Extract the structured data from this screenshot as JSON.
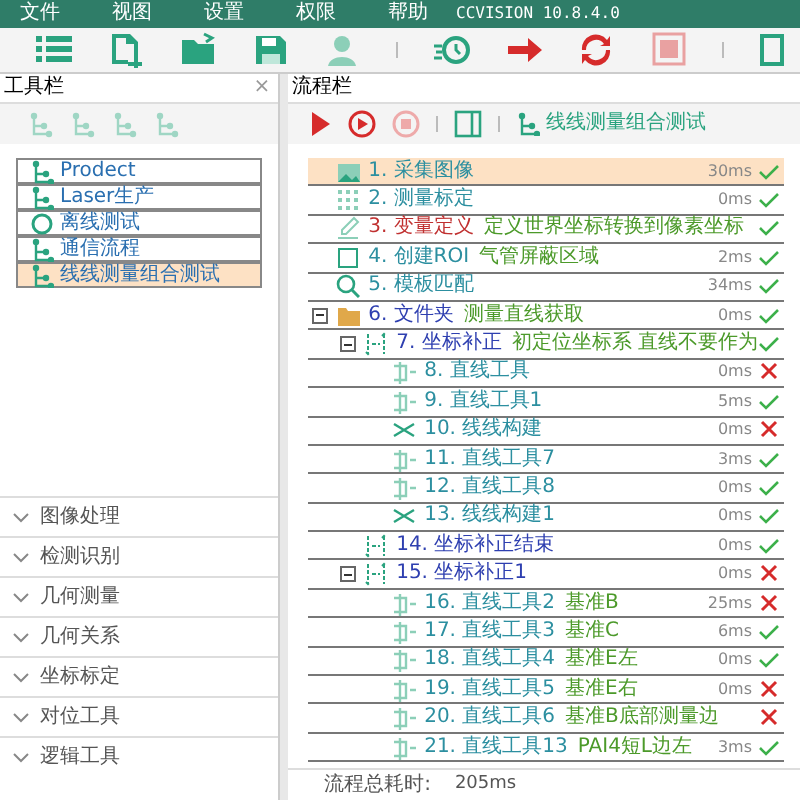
{
  "menu": {
    "items": [
      "文件",
      "视图",
      "设置",
      "权限",
      "帮助"
    ],
    "version": "CCVISION 10.8.4.0"
  },
  "toolbar": [
    {
      "kind": "list"
    },
    {
      "kind": "new"
    },
    {
      "kind": "open"
    },
    {
      "kind": "save"
    },
    {
      "kind": "user"
    },
    {
      "kind": "sep"
    },
    {
      "kind": "timer"
    },
    {
      "kind": "arrow"
    },
    {
      "kind": "refresh"
    },
    {
      "kind": "stop"
    },
    {
      "kind": "sep"
    },
    {
      "kind": "partial"
    }
  ],
  "tool_panel": {
    "title": "工具栏",
    "close": "×",
    "projects": [
      {
        "kind": "flow",
        "label": "Prodect",
        "selected": false
      },
      {
        "kind": "flow",
        "label": "Laser生产",
        "selected": false
      },
      {
        "kind": "ring",
        "label": "离线测试",
        "selected": false
      },
      {
        "kind": "flow",
        "label": "通信流程",
        "selected": false
      },
      {
        "kind": "flow",
        "label": "线线测量组合测试",
        "selected": true
      }
    ],
    "groups": [
      "图像处理",
      "检测识别",
      "几何测量",
      "几何关系",
      "坐标标定",
      "对位工具",
      "逻辑工具"
    ]
  },
  "flow_panel": {
    "title": "流程栏",
    "flow_name": "线线测量组合测试",
    "steps": [
      {
        "kind": "image",
        "name": "1. 采集图像",
        "time": "30ms",
        "ok": true,
        "selected": true
      },
      {
        "kind": "grid",
        "name": "2. 测量标定",
        "time": "0ms",
        "ok": true,
        "selected": false
      },
      {
        "kind": "var",
        "name": "3. 变量定义",
        "note": "定义世界坐标转换到像素坐标",
        "ok": true,
        "selected": false
      },
      {
        "kind": "roi",
        "name": "4. 创建ROI",
        "note": "气管屏蔽区域",
        "time": "2ms",
        "ok": true,
        "selected": false
      },
      {
        "kind": "match",
        "name": "5. 模板匹配",
        "time": "34ms",
        "ok": true,
        "selected": false
      },
      {
        "kind": "folder",
        "name": "6. 文件夹",
        "note": "测量直线获取",
        "time": "0ms",
        "ok": true,
        "selected": false,
        "expanded": true,
        "children": [
          {
            "kind": "coord",
            "name": "7. 坐标补正",
            "note": "初定位坐标系 直线不要作为",
            "ok": true,
            "selected": false,
            "expanded": true,
            "children": [
              {
                "kind": "line",
                "name": "8. 直线工具",
                "time": "0ms",
                "ok": false,
                "selected": false
              },
              {
                "kind": "line",
                "name": "9. 直线工具1",
                "time": "5ms",
                "ok": true,
                "selected": false
              },
              {
                "kind": "build",
                "name": "10. 线线构建",
                "time": "0ms",
                "ok": false,
                "selected": false
              },
              {
                "kind": "line",
                "name": "11. 直线工具7",
                "time": "3ms",
                "ok": true,
                "selected": false
              },
              {
                "kind": "line",
                "name": "12. 直线工具8",
                "time": "0ms",
                "ok": true,
                "selected": false
              },
              {
                "kind": "build",
                "name": "13. 线线构建1",
                "time": "0ms",
                "ok": true,
                "selected": false
              }
            ]
          },
          {
            "kind": "coord",
            "name": "14. 坐标补正结束",
            "time": "0ms",
            "ok": true,
            "selected": false
          },
          {
            "kind": "coord",
            "name": "15. 坐标补正1",
            "time": "0ms",
            "ok": false,
            "selected": false,
            "expanded": true,
            "children": [
              {
                "kind": "line",
                "name": "16. 直线工具2",
                "note": "基准B",
                "time": "25ms",
                "ok": false,
                "selected": false
              },
              {
                "kind": "line",
                "name": "17. 直线工具3",
                "note": "基准C",
                "time": "6ms",
                "ok": true,
                "selected": false
              },
              {
                "kind": "line",
                "name": "18. 直线工具4",
                "note": "基准E左",
                "time": "0ms",
                "ok": true,
                "selected": false
              },
              {
                "kind": "line",
                "name": "19. 直线工具5",
                "note": "基准E右",
                "time": "0ms",
                "ok": false,
                "selected": false
              },
              {
                "kind": "line",
                "name": "20. 直线工具6",
                "note": "基准B底部测量边",
                "ok": false,
                "selected": false
              },
              {
                "kind": "line",
                "name": "21. 直线工具13",
                "note": "PAI4短L边左",
                "time": "3ms",
                "ok": true,
                "selected": false
              }
            ]
          }
        ]
      }
    ],
    "total_label": "流程总耗时:",
    "total": "205ms"
  }
}
